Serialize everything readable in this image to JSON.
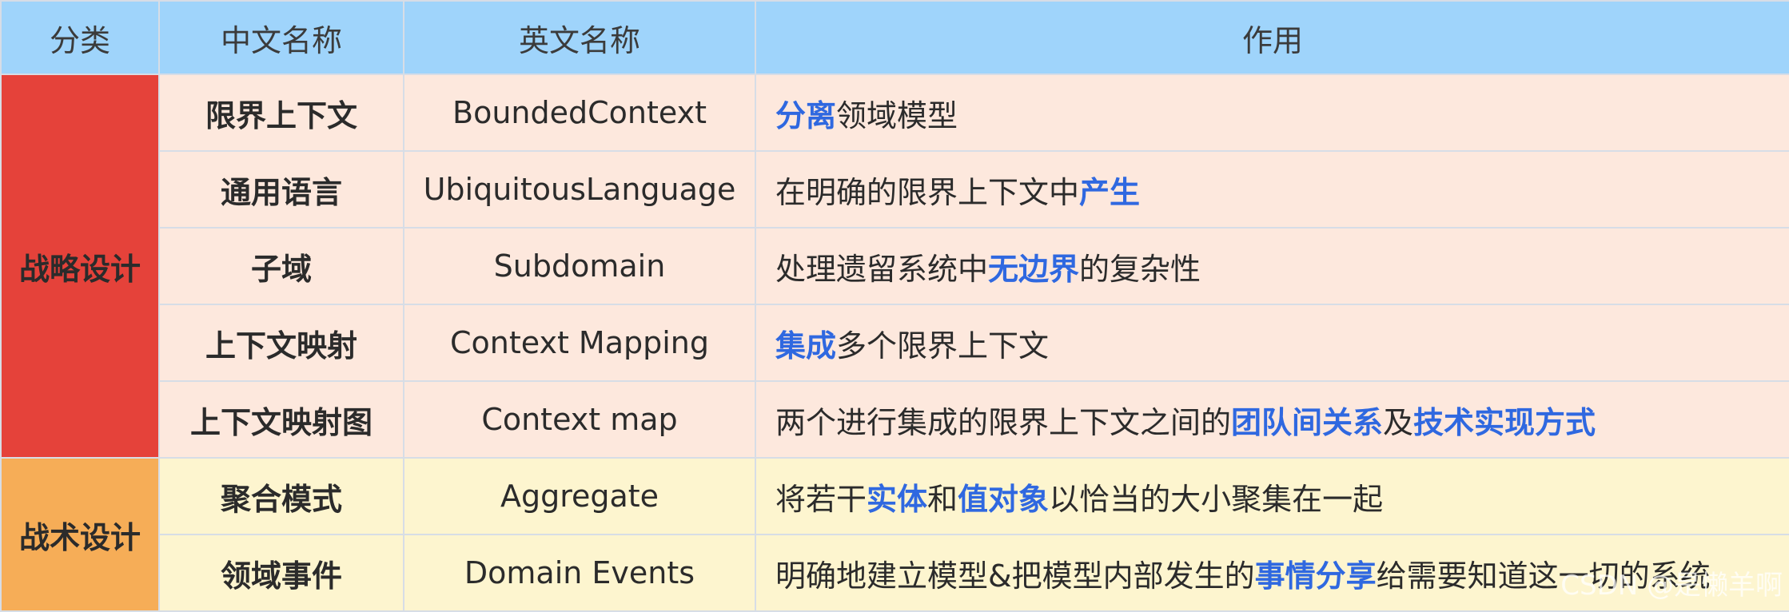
{
  "headers": [
    "分类",
    "中文名称",
    "英文名称",
    "作用"
  ],
  "categories": {
    "strategic": "战略设计",
    "tactical": "战术设计"
  },
  "rows": [
    {
      "cn": "限界上下文",
      "en": "BoundedContext",
      "purpose": [
        {
          "text": "分离",
          "highlight": true
        },
        {
          "text": "领域模型",
          "highlight": false
        }
      ]
    },
    {
      "cn": "通用语言",
      "en": "UbiquitousLanguage",
      "purpose": [
        {
          "text": "在明确的限界上下文中",
          "highlight": false
        },
        {
          "text": "产生",
          "highlight": true
        }
      ]
    },
    {
      "cn": "子域",
      "en": "Subdomain",
      "purpose": [
        {
          "text": "处理遗留系统中",
          "highlight": false
        },
        {
          "text": "无边界",
          "highlight": true
        },
        {
          "text": "的复杂性",
          "highlight": false
        }
      ]
    },
    {
      "cn": "上下文映射",
      "en": "Context Mapping",
      "purpose": [
        {
          "text": "集成",
          "highlight": true
        },
        {
          "text": "多个限界上下文",
          "highlight": false
        }
      ]
    },
    {
      "cn": "上下文映射图",
      "en": "Context map",
      "purpose": [
        {
          "text": "两个进行集成的限界上下文之间的",
          "highlight": false
        },
        {
          "text": "团队间关系",
          "highlight": true
        },
        {
          "text": "及",
          "highlight": false
        },
        {
          "text": "技术实现方式",
          "highlight": true
        }
      ]
    },
    {
      "cn": "聚合模式",
      "en": "Aggregate",
      "purpose": [
        {
          "text": "将若干",
          "highlight": false
        },
        {
          "text": "实体",
          "highlight": true
        },
        {
          "text": "和",
          "highlight": false
        },
        {
          "text": "值对象",
          "highlight": true
        },
        {
          "text": "以恰当的大小聚集在一起",
          "highlight": false
        }
      ]
    },
    {
      "cn": "领域事件",
      "en": "Domain Events",
      "purpose": [
        {
          "text": "明确地建立模型&把模型内部发生的",
          "highlight": false
        },
        {
          "text": "事情分享",
          "highlight": true
        },
        {
          "text": "给需要知道这一切的系统",
          "highlight": false
        }
      ]
    }
  ],
  "watermark": "CSDN @是懒羊啊",
  "colors": {
    "header_bg": "#9fd4fb",
    "strategic_category_bg": "#e5423a",
    "strategic_row_bg": "#fde8dd",
    "tactical_category_bg": "#f6ad57",
    "tactical_row_bg": "#fdf5cf",
    "highlight_text": "#2f68e0"
  }
}
